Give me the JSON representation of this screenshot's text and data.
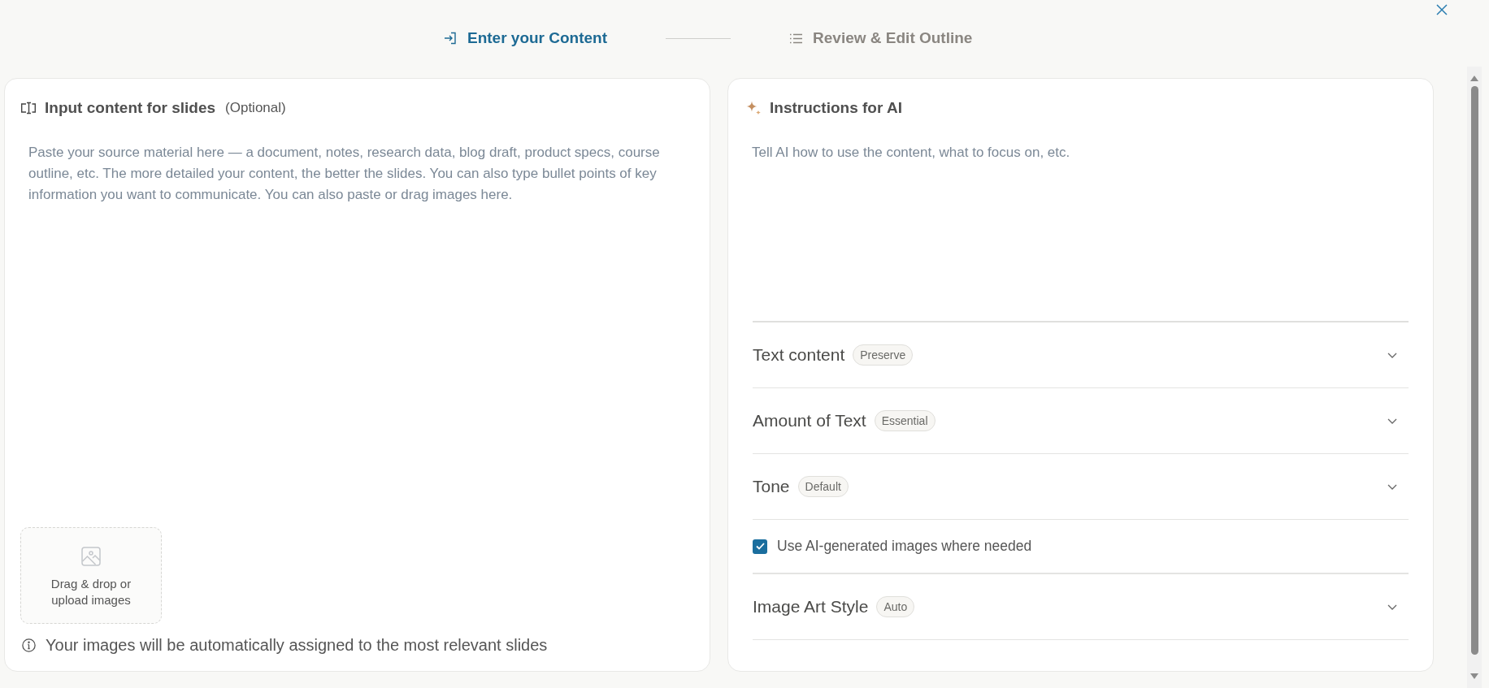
{
  "stepper": {
    "steps": [
      {
        "label": "Enter your Content",
        "selected": true
      },
      {
        "label": "Review & Edit Outline",
        "selected": false
      }
    ]
  },
  "content_panel": {
    "title": "Input content for slides",
    "subtitle": "(Optional)",
    "placeholder": "Paste your source material here — a document, notes, research data, blog draft, product specs, course outline, etc. The more detailed your content, the better the slides. You can also type bullet points of key information you want to communicate. You can also paste or drag images here.",
    "upload_label": "Drag & drop or upload images",
    "note": "Your images will be automatically assigned to the most relevant slides"
  },
  "instructions_panel": {
    "title": "Instructions for AI",
    "placeholder": "Tell AI how to use the content, what to focus on, etc.",
    "settings": [
      {
        "kind": "select",
        "label": "Text content",
        "value": "Preserve"
      },
      {
        "kind": "select",
        "label": "Amount of Text",
        "value": "Essential"
      },
      {
        "kind": "select",
        "label": "Tone",
        "value": "Default"
      },
      {
        "kind": "checkbox",
        "label": "Use AI-generated images where needed",
        "checked": true
      },
      {
        "kind": "select",
        "label": "Image Art Style",
        "value": "Auto"
      }
    ]
  }
}
